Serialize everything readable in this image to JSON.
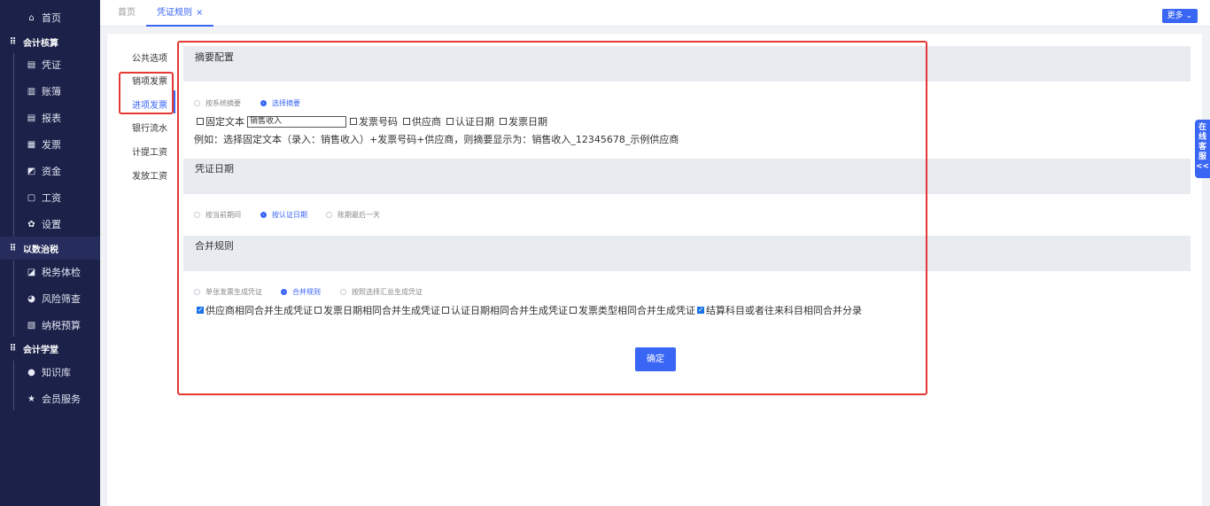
{
  "sidebar": {
    "home": "首页",
    "groups": [
      {
        "label": "会计核算",
        "items": [
          "凭证",
          "账簿",
          "报表",
          "发票",
          "资金",
          "工资",
          "设置"
        ]
      },
      {
        "label": "以数治税",
        "items": [
          "税务体检",
          "风险筛查",
          "纳税预算"
        ]
      },
      {
        "label": "会计学堂",
        "items": [
          "知识库",
          "会员服务"
        ]
      }
    ]
  },
  "tabs": [
    {
      "label": "首页"
    },
    {
      "label": "凭证规则",
      "close": "×"
    }
  ],
  "more_button": "更多 ⌄",
  "inner_nav": [
    "公共选项",
    "销项发票",
    "进项发票",
    "银行流水",
    "计提工资",
    "发放工资"
  ],
  "summary_section": {
    "title": "摘要配置",
    "radios": [
      {
        "label": "按系统摘要",
        "checked": false
      },
      {
        "label": "选择摘要",
        "checked": true
      }
    ],
    "checks": [
      {
        "label": "固定文本",
        "checked": false
      },
      {
        "label": "发票号码",
        "checked": false
      },
      {
        "label": "供应商",
        "checked": false
      },
      {
        "label": "认证日期",
        "checked": false
      },
      {
        "label": "发票日期",
        "checked": false
      }
    ],
    "fixed_text_value": "销售收入",
    "example": "例如：选择固定文本（录入：销售收入）+发票号码+供应商，则摘要显示为：销售收入_12345678_示例供应商"
  },
  "date_section": {
    "title": "凭证日期",
    "radios": [
      {
        "label": "按当前期间",
        "checked": false
      },
      {
        "label": "按认证日期",
        "checked": true
      },
      {
        "label": "账期最后一天",
        "checked": false
      }
    ]
  },
  "merge_section": {
    "title": "合并规则",
    "radios": [
      {
        "label": "单张发票生成凭证",
        "checked": false
      },
      {
        "label": "合并规则",
        "checked": true
      },
      {
        "label": "按照选择汇总生成凭证",
        "checked": false
      }
    ],
    "checks": [
      {
        "label": "供应商相同合并生成凭证",
        "checked": true
      },
      {
        "label": "发票日期相同合并生成凭证",
        "checked": false
      },
      {
        "label": "认证日期相同合并生成凭证",
        "checked": false
      },
      {
        "label": "发票类型相同合并生成凭证",
        "checked": false
      },
      {
        "label": "结算科目或者往来科目相同合并分录",
        "checked": true
      }
    ]
  },
  "confirm_button": "确定",
  "service_tab": "在线客服<<",
  "colors": {
    "accent": "#3a66f5",
    "sidebar_bg": "#1b2149",
    "highlight": "#e53935"
  }
}
